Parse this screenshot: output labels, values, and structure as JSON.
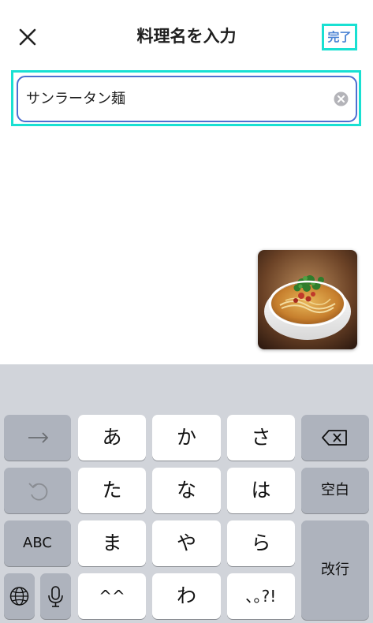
{
  "header": {
    "title": "料理名を入力",
    "done_label": "完了",
    "close_icon": "close-icon"
  },
  "input": {
    "value": "サンラータン麺",
    "clear_icon": "clear-circle-icon"
  },
  "thumbnail": {
    "icon": "food-photo-noodle-soup"
  },
  "keyboard": {
    "row1": [
      "あ",
      "か",
      "さ"
    ],
    "row2": [
      "た",
      "な",
      "は"
    ],
    "row3": [
      "ま",
      "や",
      "ら"
    ],
    "row4": [
      "^^",
      "わ",
      "､｡?!"
    ],
    "space_label": "空白",
    "enter_label": "改行",
    "abc_label": "ABC",
    "arrow_icon": "right-arrow-icon",
    "undo_icon": "undo-icon",
    "backspace_icon": "backspace-icon",
    "globe_icon": "globe-icon",
    "mic_icon": "microphone-icon"
  },
  "colors": {
    "highlight": "#19e0d2",
    "input_border": "#4d6fd1",
    "done_text": "#4a83d4",
    "keyboard_bg": "#d1d4da",
    "fn_key": "#aeb3bd"
  }
}
